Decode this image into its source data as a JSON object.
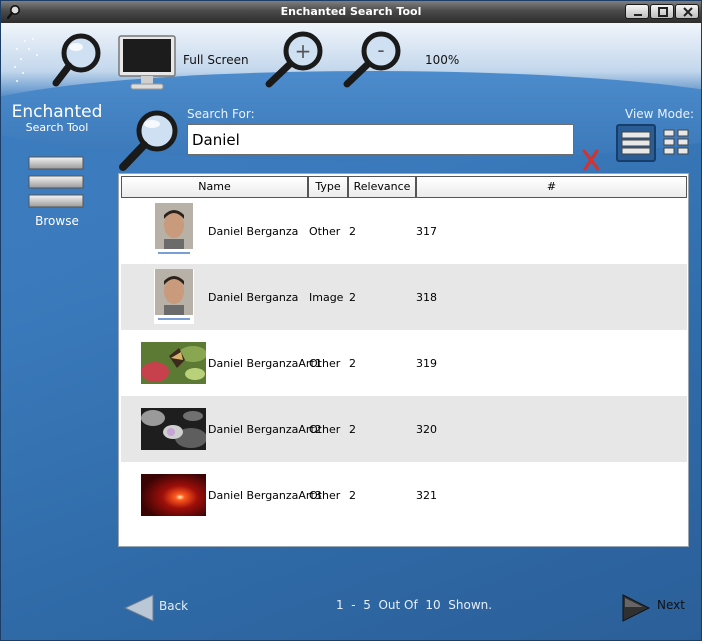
{
  "window": {
    "title": "Enchanted Search Tool"
  },
  "toolbar": {
    "full_screen_label": "Full Screen",
    "zoom_level": "100%"
  },
  "brand": {
    "name": "Enchanted",
    "subtitle": "Search Tool"
  },
  "sidebar": {
    "browse_label": "Browse"
  },
  "search": {
    "label": "Search For:",
    "value": "Daniel"
  },
  "view_mode": {
    "label": "View Mode:",
    "selected": "list"
  },
  "table": {
    "columns": [
      "Name",
      "Type",
      "Relevance",
      "#"
    ],
    "rows": [
      {
        "name": "Daniel Berganza",
        "type": "Other",
        "relevance": "2",
        "number": "317",
        "thumb": "portrait"
      },
      {
        "name": "Daniel Berganza",
        "type": "Image",
        "relevance": "2",
        "number": "318",
        "thumb": "portrait"
      },
      {
        "name": "Daniel BerganzaArt1",
        "type": "Other",
        "relevance": "2",
        "number": "319",
        "thumb": "butterfly"
      },
      {
        "name": "Daniel BerganzaArt2",
        "type": "Other",
        "relevance": "2",
        "number": "320",
        "thumb": "grayscale-flower"
      },
      {
        "name": "Daniel BerganzaArt3",
        "type": "Other",
        "relevance": "2",
        "number": "321",
        "thumb": "red-light"
      }
    ]
  },
  "footer": {
    "back_label": "Back",
    "next_label": "Next",
    "pager_text": "1  -  5  Out Of  10  Shown."
  },
  "colors": {
    "background": "#2f69a6",
    "row_alt": "#e7e7e7",
    "clear_icon": "#d9302a"
  }
}
